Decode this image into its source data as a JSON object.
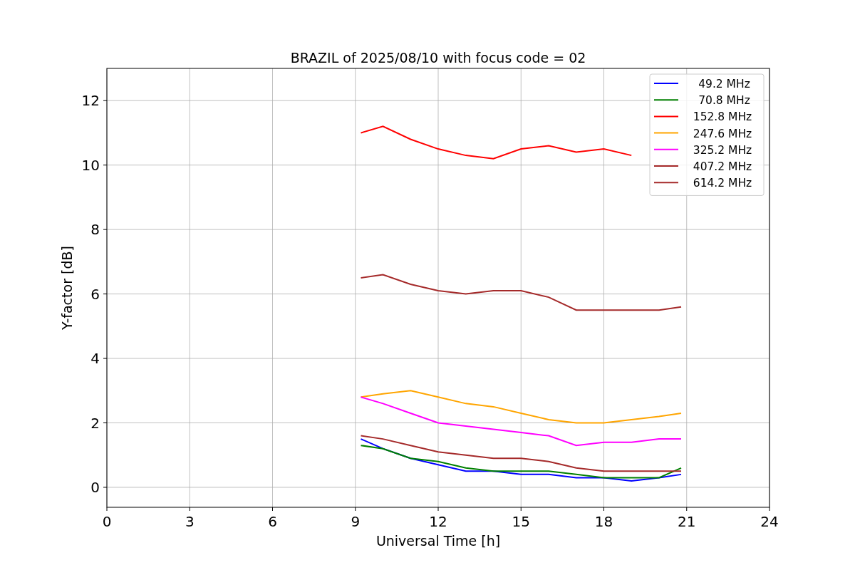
{
  "chart_data": {
    "type": "line",
    "title": "BRAZIL of 2025/08/10 with focus code = 02",
    "xlabel": "Universal Time [h]",
    "ylabel": "Y-factor [dB]",
    "x": [
      9.2,
      10,
      11,
      12,
      13,
      14,
      15,
      16,
      17,
      18,
      19,
      20,
      20.8
    ],
    "grid": true,
    "legend": true,
    "xlim": [
      0,
      24
    ],
    "ylim": [
      -0.62,
      13
    ],
    "xticks": [
      0,
      3,
      6,
      9,
      12,
      15,
      18,
      21,
      24
    ],
    "yticks": [
      0,
      2,
      4,
      6,
      8,
      10,
      12
    ],
    "series": [
      {
        "name": " 49.2 MHz",
        "color": "#0000ff",
        "values": [
          1.5,
          1.2,
          0.9,
          0.7,
          0.5,
          0.5,
          0.4,
          0.4,
          0.3,
          0.3,
          0.2,
          0.3,
          0.4
        ]
      },
      {
        "name": " 70.8 MHz",
        "color": "#008000",
        "values": [
          1.3,
          1.2,
          0.9,
          0.8,
          0.6,
          0.5,
          0.5,
          0.5,
          0.4,
          0.3,
          0.3,
          0.3,
          0.6
        ]
      },
      {
        "name": "152.8 MHz",
        "color": "#ff0000",
        "values": [
          11,
          11.2,
          10.8,
          10.5,
          10.3,
          10.2,
          10.5,
          10.6,
          10.4,
          10.5,
          10.3,
          null,
          null
        ]
      },
      {
        "name": "247.6 MHz",
        "color": "#ffa500",
        "values": [
          2.8,
          2.9,
          3.0,
          2.8,
          2.6,
          2.5,
          2.3,
          2.1,
          2.0,
          2.0,
          2.1,
          2.2,
          2.3
        ]
      },
      {
        "name": "325.2 MHz",
        "color": "#ff00ff",
        "values": [
          2.8,
          2.6,
          2.3,
          2.0,
          1.9,
          1.8,
          1.7,
          1.6,
          1.3,
          1.4,
          1.4,
          1.5,
          1.5
        ]
      },
      {
        "name": "407.2 MHz",
        "color": "#a52a2a",
        "values": [
          6.5,
          6.6,
          6.3,
          6.1,
          6.0,
          6.1,
          6.1,
          5.9,
          5.5,
          5.5,
          5.5,
          5.5,
          5.6
        ]
      },
      {
        "name": "614.2 MHz",
        "color": "#a52a2a",
        "values": [
          1.6,
          1.5,
          1.3,
          1.1,
          1.0,
          0.9,
          0.9,
          0.8,
          0.6,
          0.5,
          0.5,
          0.5,
          0.5
        ]
      }
    ]
  }
}
